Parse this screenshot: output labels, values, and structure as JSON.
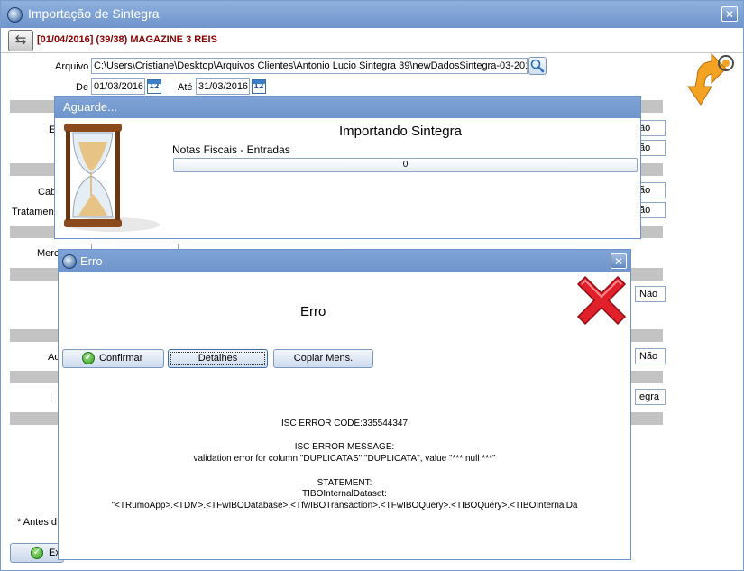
{
  "main_window": {
    "title": "Importação de Sintegra",
    "close_symbol": "✕",
    "nav_icon": "swap-arrows-icon",
    "header": "[01/04/2016] (39/38) MAGAZINE 3 REIS",
    "arquivo_label": "Arquivo",
    "arquivo_value": "C:\\Users\\Cristiane\\Desktop\\Arquivos Clientes\\Antonio Lucio Sintegra 39\\newDadosSintegra-03-2016",
    "de_label": "De",
    "de_value": "01/03/2016",
    "ate_label": "Até",
    "ate_value": "31/03/2016",
    "cal_icon_text": "12",
    "partial_labels": {
      "e": "E",
      "cab": "Cab",
      "tratamen": "Tratamen",
      "merc": "Merc",
      "ad": "Ad",
      "i": "I",
      "antes": "* Antes d"
    },
    "side_values": [
      "ão",
      "ão",
      "ão",
      "ão",
      "Não",
      "Não",
      "egra"
    ],
    "bottom_button_label": "Ex"
  },
  "wait_dialog": {
    "title": "Aguarde...",
    "heading": "Importando Sintegra",
    "subtext": "Notas Fiscais - Entradas",
    "progress_value": "0",
    "icon": "hourglass-icon"
  },
  "error_dialog": {
    "title": "Erro",
    "close_symbol": "✕",
    "heading": "Erro",
    "icon": "red-x-icon",
    "buttons": {
      "confirmar": "Confirmar",
      "detalhes": "Detalhes",
      "copiar": "Copiar Mens."
    },
    "messages": {
      "code": "ISC ERROR CODE:335544347",
      "msg_title": "ISC ERROR MESSAGE:",
      "msg_body": "validation error for column \"DUPLICATAS\".\"DUPLICATA\", value \"*** null ***\"",
      "statement_title": "STATEMENT:",
      "statement_obj": "TIBOInternalDataset:",
      "statement_chain": "\"<TRumoApp>.<TDM>.<TFwIBODatabase>.<TfwIBOTransaction>.<TFwIBOQuery>.<TIBOQuery>.<TIBOInternalDa"
    }
  },
  "colors": {
    "titlebar": "#6f95cc",
    "header_text": "#8b0000",
    "gray_bar": "#c3c3c3"
  }
}
